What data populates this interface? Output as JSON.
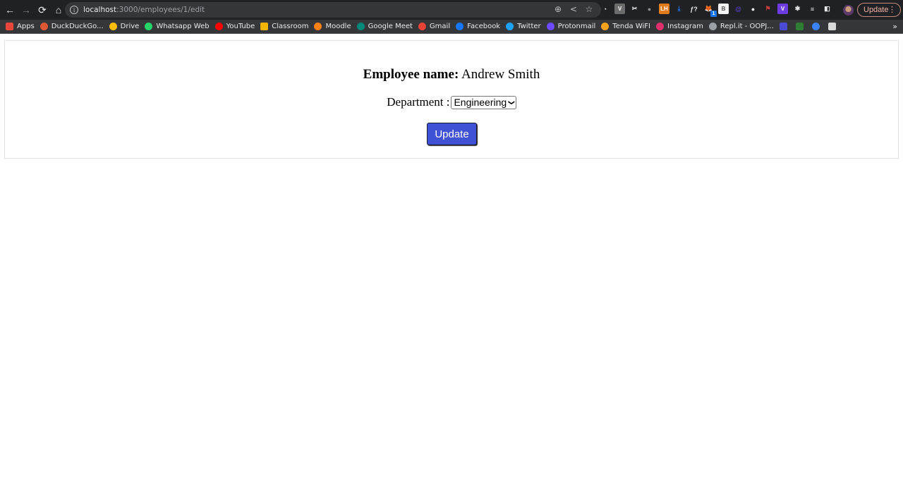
{
  "browser": {
    "url_host": "localhost",
    "url_path": ":3000/employees/1/edit",
    "update_label": "Update",
    "nav": {
      "back": "←",
      "forward": "→",
      "reload": "⟳",
      "home": "⌂"
    },
    "omnibox_actions": [
      "zoom-icon",
      "share-icon",
      "star-icon"
    ],
    "extensions": [
      {
        "name": "speedometer-extension",
        "glyph": "◔",
        "color": "#2a2a2a"
      },
      {
        "name": "v-extension",
        "glyph": "V",
        "color": "#6b6b6b"
      },
      {
        "name": "leaf-extension",
        "glyph": "✂",
        "color": "#2b2b2b"
      },
      {
        "name": "circle-extension",
        "glyph": "●",
        "color": "#8a8a8a"
      },
      {
        "name": "lh-extension",
        "glyph": "LH",
        "color": "#e07b1a"
      },
      {
        "name": "download-extension",
        "glyph": "⤓",
        "color": "#1a73e8"
      },
      {
        "name": "formula-extension",
        "glyph": "ƒ?",
        "color": "#2b2b2b"
      },
      {
        "name": "metamask-extension",
        "glyph": "🦊",
        "color": "#e2761b",
        "badge": "1"
      },
      {
        "name": "square-extension",
        "glyph": "B",
        "color": "#f1f1f1"
      },
      {
        "name": "at-extension",
        "glyph": "@",
        "color": "#5b3cc4"
      },
      {
        "name": "github-extension",
        "glyph": "●",
        "color": "#2b2b2b"
      },
      {
        "name": "flag-extension",
        "glyph": "⚑",
        "color": "#c43c3c"
      },
      {
        "name": "v-purple-extension",
        "glyph": "V",
        "color": "#6c3ce0"
      },
      {
        "name": "puzzle-extension",
        "glyph": "✱",
        "color": "#2b2b2b"
      },
      {
        "name": "media-extension",
        "glyph": "≡",
        "color": "#2b2b2b"
      },
      {
        "name": "sidepanel-extension",
        "glyph": "◧",
        "color": "#2b2b2b"
      }
    ],
    "bookmarks": [
      {
        "label": "Apps",
        "icon": "apps-grid-icon",
        "color": "#e8453c"
      },
      {
        "label": "DuckDuckGo...",
        "icon": "duckduckgo-icon",
        "color": "#de5833"
      },
      {
        "label": "Drive",
        "icon": "drive-icon",
        "color": "#fbbc04"
      },
      {
        "label": "Whatsapp Web",
        "icon": "whatsapp-icon",
        "color": "#25d366"
      },
      {
        "label": "YouTube",
        "icon": "youtube-icon",
        "color": "#ff0000"
      },
      {
        "label": "Classroom",
        "icon": "classroom-icon",
        "color": "#f5b400"
      },
      {
        "label": "Moodle",
        "icon": "moodle-icon",
        "color": "#f98012"
      },
      {
        "label": "Google Meet",
        "icon": "google-meet-icon",
        "color": "#00897b"
      },
      {
        "label": "Gmail",
        "icon": "gmail-icon",
        "color": "#ea4335"
      },
      {
        "label": "Facebook",
        "icon": "facebook-icon",
        "color": "#1877f2"
      },
      {
        "label": "Twitter",
        "icon": "twitter-icon",
        "color": "#1da1f2"
      },
      {
        "label": "Protonmail",
        "icon": "protonmail-icon",
        "color": "#6d4aff"
      },
      {
        "label": "Tenda WiFI",
        "icon": "tenda-icon",
        "color": "#f7a21b"
      },
      {
        "label": "Instagram",
        "icon": "instagram-icon",
        "color": "#e1306c"
      },
      {
        "label": "Repl.it - OOPJ...",
        "icon": "replit-icon",
        "color": "#9aa0a6"
      },
      {
        "label": "",
        "icon": "terminal-icon",
        "color": "#4b4bd6"
      },
      {
        "label": "",
        "icon": "emblem-icon",
        "color": "#2e7d32"
      },
      {
        "label": "",
        "icon": "runner-icon",
        "color": "#3b82f6"
      },
      {
        "label": "",
        "icon": "document-icon",
        "color": "#d9d9d9"
      }
    ],
    "bookmarks_more": "»"
  },
  "form": {
    "employee_label": "Employee name:",
    "employee_name": "Andrew Smith",
    "department_label": "Department :",
    "department_selected": "Engineering",
    "update_button": "Update",
    "button_color": "#3f51d4"
  }
}
